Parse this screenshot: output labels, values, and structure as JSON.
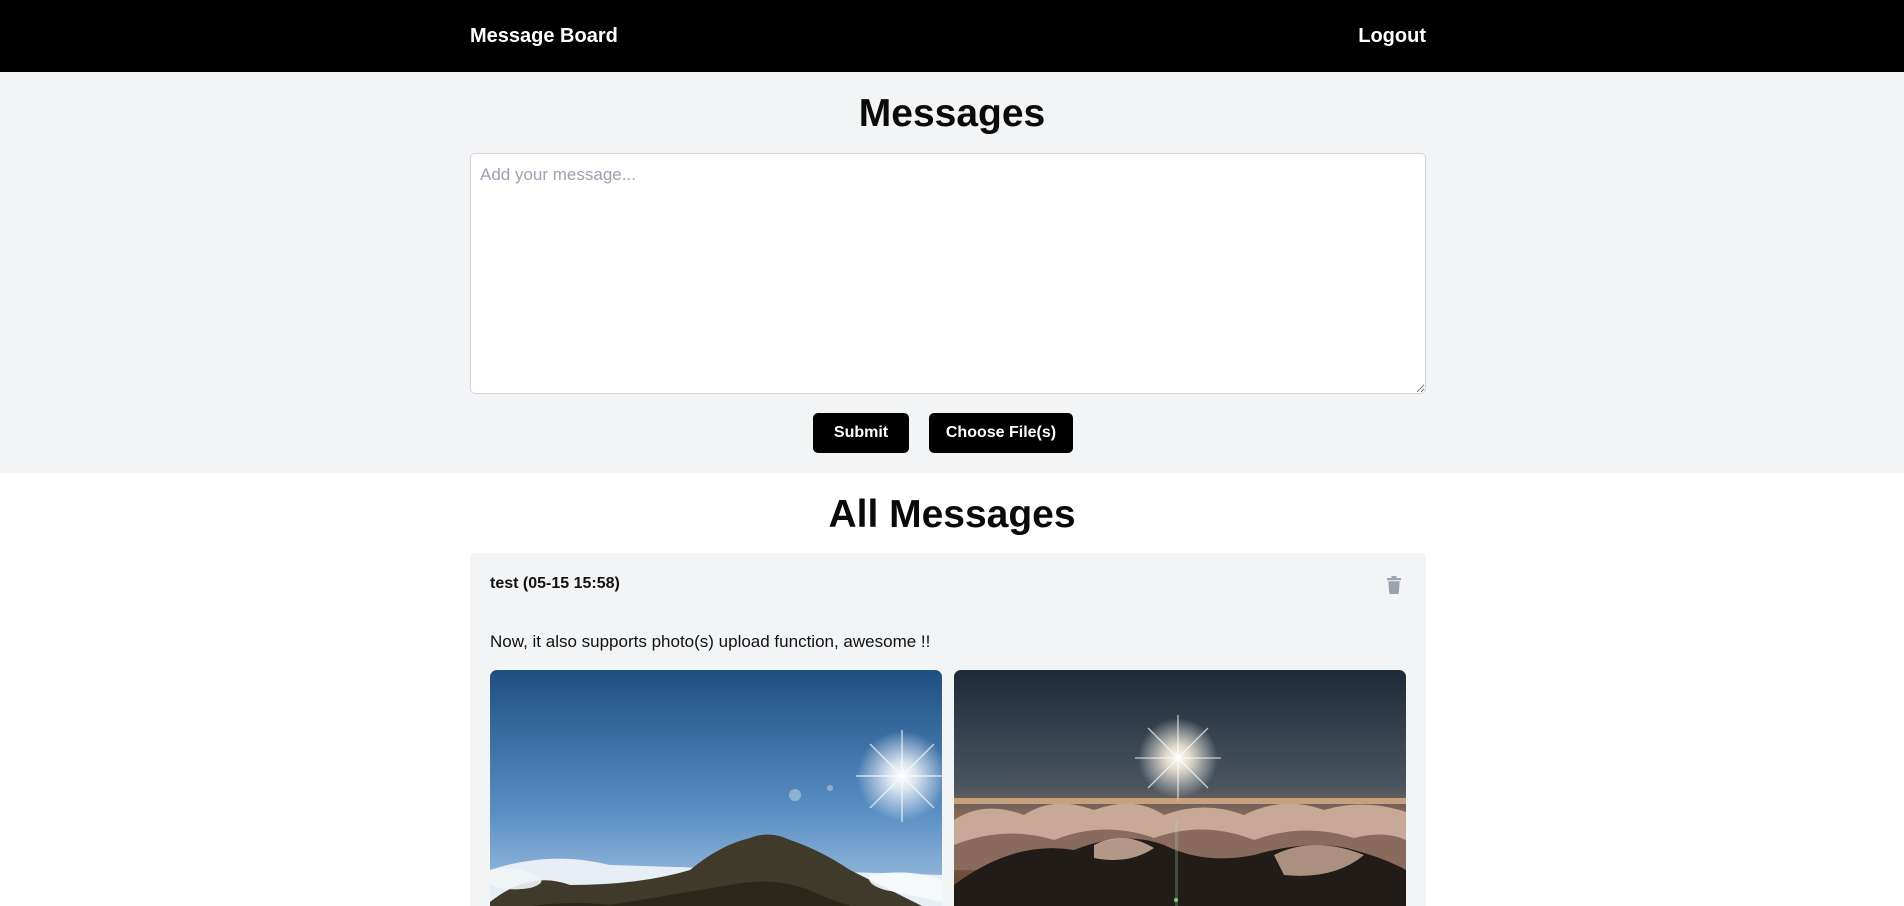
{
  "navbar": {
    "brand": "Message Board",
    "logout": "Logout"
  },
  "compose": {
    "title": "Messages",
    "placeholder": "Add your message...",
    "value": "",
    "submit_label": "Submit",
    "file_label": "Choose File(s)"
  },
  "messages_section": {
    "title": "All Messages",
    "items": [
      {
        "author_time": "test (05-15 15:58)",
        "body": "Now, it also supports photo(s) upload function, awesome !!",
        "delete_icon": "trash-icon",
        "photos": [
          {
            "icon": "mountain-sun-photo"
          },
          {
            "icon": "sunset-clouds-photo"
          }
        ]
      }
    ]
  },
  "colors": {
    "navbar_bg": "#000000",
    "compose_bg": "#f3f4f6",
    "card_bg": "#f3f4f6",
    "button_bg": "#000000",
    "button_text": "#ffffff",
    "placeholder": "#9ca3af",
    "trash_icon": "#9ca3af"
  }
}
